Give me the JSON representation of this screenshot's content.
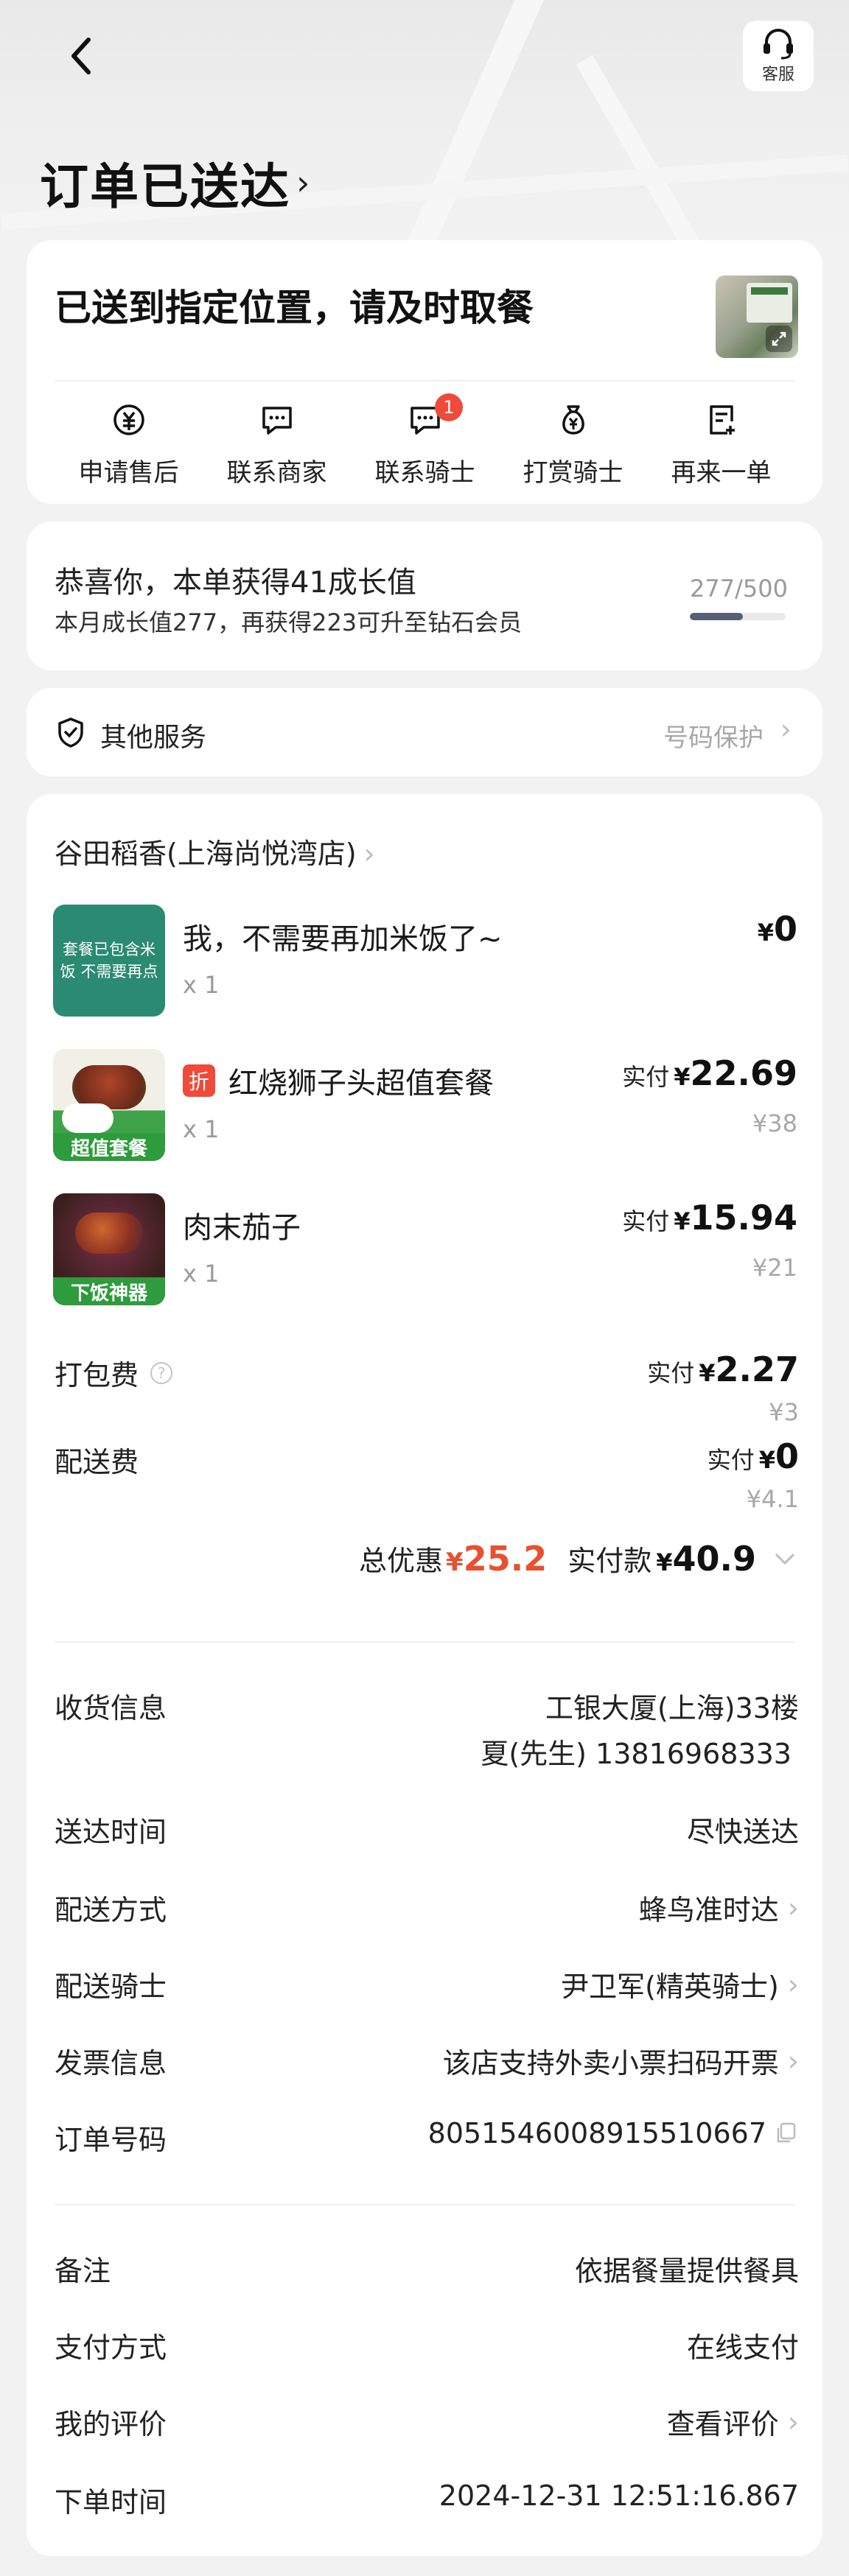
{
  "header": {
    "service_label": "客服",
    "status_title": "订单已送达"
  },
  "delivery_card": {
    "message": "已送到指定位置，请及时取餐",
    "actions": [
      {
        "label": "申请售后",
        "icon": "after-sale-icon"
      },
      {
        "label": "联系商家",
        "icon": "chat-merchant-icon"
      },
      {
        "label": "联系骑士",
        "icon": "chat-rider-icon",
        "badge": "1"
      },
      {
        "label": "打赏骑士",
        "icon": "tip-bag-icon"
      },
      {
        "label": "再来一单",
        "icon": "reorder-icon"
      }
    ]
  },
  "growth": {
    "main": "恭喜你，本单获得41成长值",
    "sub": "本月成长值277，再获得223可升至钻石会员",
    "progress_text": "277/500",
    "progress_value": 277,
    "progress_max": 500
  },
  "other_services": {
    "label": "其他服务",
    "right_text": "号码保护"
  },
  "order": {
    "shop_name": "谷田稻香(上海尚悦湾店)",
    "items": [
      {
        "name": "我，不需要再加米饭了~",
        "qty": "x 1",
        "paid_label": "",
        "price": "0",
        "original": "",
        "discount": "",
        "image_text": "套餐已包含米饭 不需要再点",
        "image_tag": ""
      },
      {
        "name": "红烧狮子头超值套餐",
        "qty": "x 1",
        "paid_label": "实付",
        "price": "22.69",
        "original": "¥38",
        "discount": "折",
        "image_text": "",
        "image_tag": "超值套餐"
      },
      {
        "name": "肉末茄子",
        "qty": "x 1",
        "paid_label": "实付",
        "price": "15.94",
        "original": "¥21",
        "discount": "",
        "image_text": "",
        "image_tag": "下饭神器"
      }
    ],
    "fees": [
      {
        "label": "打包费",
        "paid_label": "实付",
        "price": "2.27",
        "original": "¥3"
      },
      {
        "label": "配送费",
        "paid_label": "实付",
        "price": "0",
        "original": "¥4.1"
      }
    ],
    "currency": "¥",
    "total_discount_label": "总优惠",
    "total_discount": "25.2",
    "total_paid_label": "实付款",
    "total_paid": "40.9"
  },
  "info": {
    "receiver_label": "收货信息",
    "receiver_address": "工银大厦(上海)33楼",
    "receiver_contact": "夏(先生) 13816968333",
    "delivery_time_label": "送达时间",
    "delivery_time": "尽快送达",
    "delivery_method_label": "配送方式",
    "delivery_method": "蜂鸟准时达",
    "rider_label": "配送骑士",
    "rider": "尹卫军(精英骑士)",
    "invoice_label": "发票信息",
    "invoice": "该店支持外卖小票扫码开票",
    "order_no_label": "订单号码",
    "order_no": "8051546008915510667",
    "remark_label": "备注",
    "remark": "依据餐量提供餐具",
    "payment_label": "支付方式",
    "payment": "在线支付",
    "review_label": "我的评价",
    "review": "查看评价",
    "order_time_label": "下单时间",
    "order_time": "2024-12-31 12:51:16.867"
  },
  "colors": {
    "accent_red": "#e8502f",
    "badge_red": "#f04a3a",
    "tag_green": "#2e9b3c",
    "progress_fill": "#566074"
  }
}
